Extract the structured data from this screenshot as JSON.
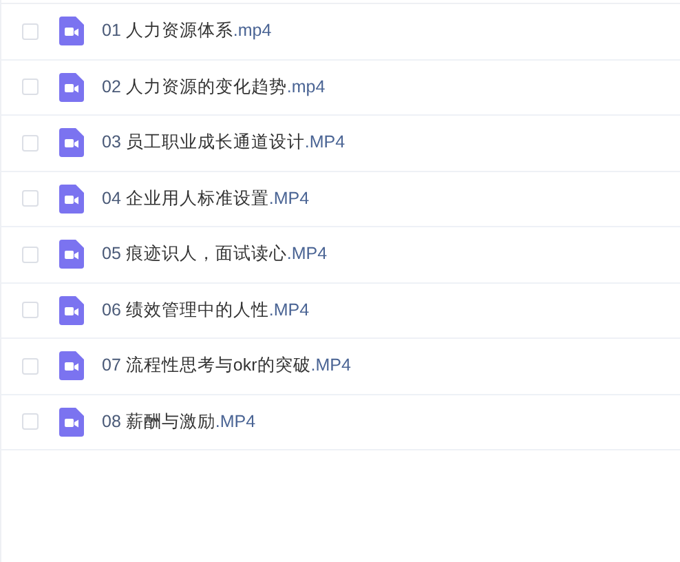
{
  "files": [
    {
      "number": "01",
      "title": "人力资源体系",
      "ext": ".mp4",
      "checked": false
    },
    {
      "number": "02",
      "title": "人力资源的变化趋势",
      "ext": ".mp4",
      "checked": false
    },
    {
      "number": "03",
      "title": "员工职业成长通道设计",
      "ext": ".MP4",
      "checked": false
    },
    {
      "number": "04",
      "title": "企业用人标准设置",
      "ext": ".MP4",
      "checked": false
    },
    {
      "number": "05",
      "title": "痕迹识人，面试读心",
      "ext": ".MP4",
      "checked": false
    },
    {
      "number": "06",
      "title": "绩效管理中的人性",
      "ext": ".MP4",
      "checked": false
    },
    {
      "number": "07",
      "title": "流程性思考与okr的突破",
      "ext": ".MP4",
      "checked": false
    },
    {
      "number": "08",
      "title": "薪酬与激励",
      "ext": ".MP4",
      "checked": false
    }
  ]
}
